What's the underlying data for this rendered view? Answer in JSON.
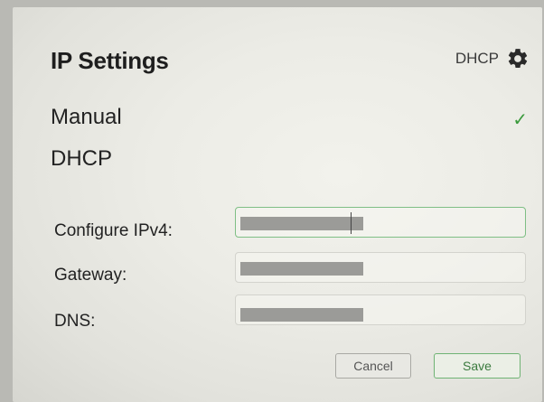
{
  "header": {
    "title": "IP Settings",
    "mode_label": "DHCP",
    "mode_icon": "gear-icon"
  },
  "options": {
    "manual_label": "Manual",
    "dhcp_label": "DHCP",
    "selected": "Manual",
    "check_glyph": "✓",
    "check_color": "#3a9a3c"
  },
  "fields": {
    "ipv4_label": "Configure IPv4:",
    "gateway_label": "Gateway:",
    "dns_label": "DNS:"
  },
  "buttons": {
    "cancel_label": "Cancel",
    "save_label": "Save"
  },
  "colors": {
    "accent_green": "#6fb374",
    "text_dark": "#222222"
  }
}
